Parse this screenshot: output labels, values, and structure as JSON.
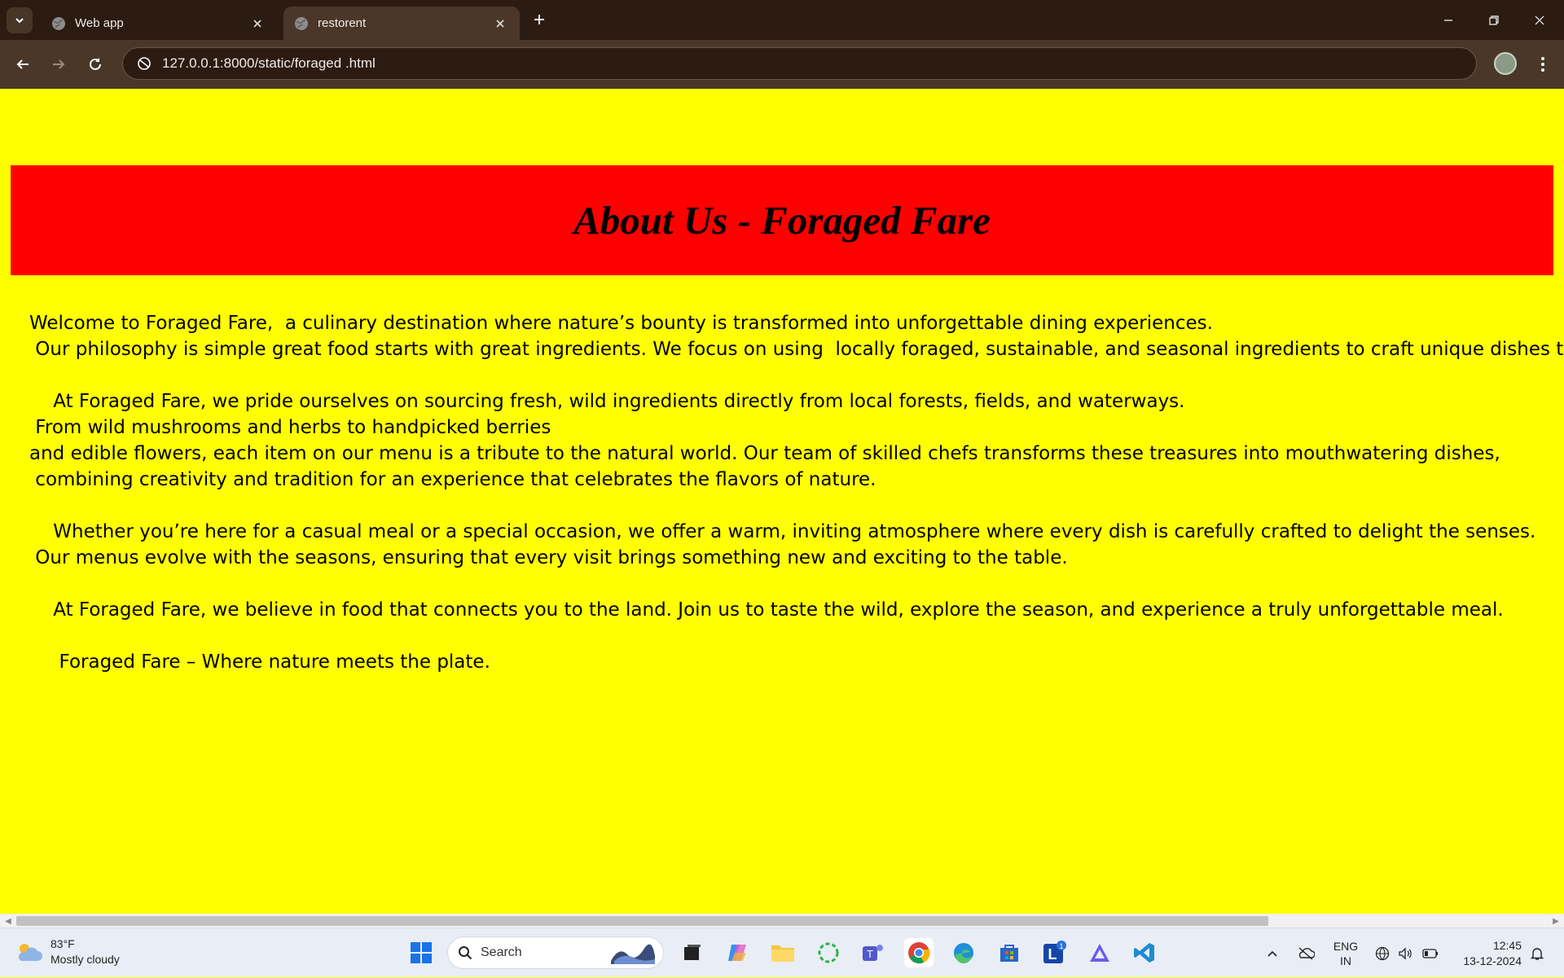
{
  "browser": {
    "tabs": [
      {
        "title": "Web app",
        "active": false
      },
      {
        "title": "restorent",
        "active": true
      }
    ],
    "url": "127.0.0.1:8000/static/foraged .html"
  },
  "page": {
    "background": "#ffff00",
    "banner_color": "#ff0000",
    "heading": "About Us - Foraged Fare",
    "lines": [
      "Welcome to Foraged Fare,  a culinary destination where nature’s bounty is transformed into unforgettable dining experiences.",
      " Our philosophy is simple great food starts with great ingredients. We focus on using  locally foraged, sustainable, and seasonal ingredients to craft unique dishes that s",
      "",
      "    At Foraged Fare, we pride ourselves on sourcing fresh, wild ingredients directly from local forests, fields, and waterways.",
      " From wild mushrooms and herbs to handpicked berries",
      "and edible flowers, each item on our menu is a tribute to the natural world. Our team of skilled chefs transforms these treasures into mouthwatering dishes,",
      " combining creativity and tradition for an experience that celebrates the flavors of nature.",
      "",
      "    Whether you’re here for a casual meal or a special occasion, we offer a warm, inviting atmosphere where every dish is carefully crafted to delight the senses.",
      " Our menus evolve with the seasons, ensuring that every visit brings something new and exciting to the table.",
      "",
      "    At Foraged Fare, we believe in food that connects you to the land. Join us to taste the wild, explore the season, and experience a truly unforgettable meal.",
      "",
      "     Foraged Fare – Where nature meets the plate."
    ]
  },
  "taskbar": {
    "weather": {
      "temp": "83°F",
      "condition": "Mostly cloudy"
    },
    "search_label": "Search",
    "teams_badge": "1",
    "language": {
      "line1": "ENG",
      "line2": "IN"
    },
    "clock": {
      "time": "12:45",
      "date": "13-12-2024"
    }
  }
}
